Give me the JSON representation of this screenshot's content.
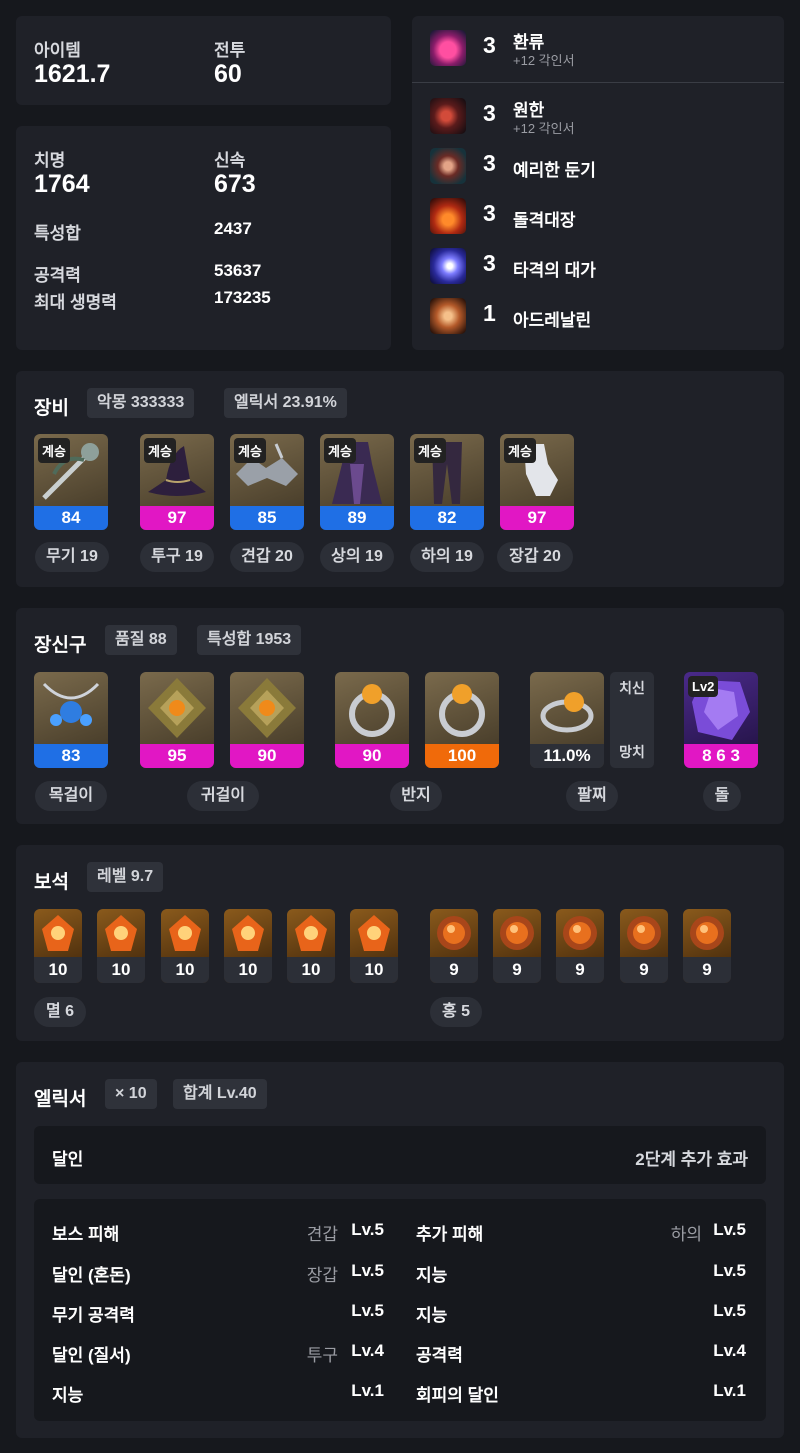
{
  "stats_top": {
    "item_label": "아이템",
    "item_value": "1621.7",
    "combat_label": "전투",
    "combat_value": "60"
  },
  "stats": {
    "crit_label": "치명",
    "crit_value": "1764",
    "swift_label": "신속",
    "swift_value": "673",
    "trait_sum_label": "특성합",
    "trait_sum_value": "2437",
    "atk_label": "공격력",
    "atk_value": "53637",
    "hp_label": "최대 생명력",
    "hp_value": "173235"
  },
  "engravings": [
    {
      "icon": "reflux-icon",
      "level": "3",
      "name": "환류",
      "sub": "+12 각인서"
    },
    {
      "icon": "grudge-icon",
      "level": "3",
      "name": "원한",
      "sub": "+12 각인서"
    },
    {
      "icon": "keen-blunt-icon",
      "level": "3",
      "name": "예리한 둔기",
      "sub": ""
    },
    {
      "icon": "raid-captain-icon",
      "level": "3",
      "name": "돌격대장",
      "sub": ""
    },
    {
      "icon": "master-brawler-icon",
      "level": "3",
      "name": "타격의 대가",
      "sub": ""
    },
    {
      "icon": "adrenaline-icon",
      "level": "1",
      "name": "아드레날린",
      "sub": ""
    }
  ],
  "equipment": {
    "title": "장비",
    "tag1": "악몽 333333",
    "tag2": "엘릭서 23.91%",
    "items": [
      {
        "badge": "계승",
        "quality": "84",
        "color": "blue",
        "label": "무기 19",
        "icon": "weapon-icon"
      },
      {
        "badge": "계승",
        "quality": "97",
        "color": "magenta",
        "label": "투구 19",
        "icon": "helmet-icon"
      },
      {
        "badge": "계승",
        "quality": "85",
        "color": "blue",
        "label": "견갑 20",
        "icon": "shoulder-icon"
      },
      {
        "badge": "계승",
        "quality": "89",
        "color": "blue",
        "label": "상의 19",
        "icon": "chest-icon"
      },
      {
        "badge": "계승",
        "quality": "82",
        "color": "blue",
        "label": "하의 19",
        "icon": "pants-icon"
      },
      {
        "badge": "계승",
        "quality": "97",
        "color": "magenta",
        "label": "장갑 20",
        "icon": "gloves-icon"
      }
    ]
  },
  "accessories": {
    "title": "장신구",
    "tag1": "품질 88",
    "tag2": "특성합 1953",
    "necklace_quality": "83",
    "earring1_quality": "95",
    "earring2_quality": "90",
    "ring1_quality": "90",
    "ring2_quality": "100",
    "bracelet_value": "11.0%",
    "bracelet_stat1": "치신",
    "bracelet_stat2": "망치",
    "stone_badge": "Lv2",
    "stone_value": "8 6 3",
    "labels": {
      "necklace": "목걸이",
      "earring": "귀걸이",
      "ring": "반지",
      "bracelet": "팔찌",
      "stone": "돌"
    }
  },
  "gems": {
    "title": "보석",
    "tag1": "레벨 9.7",
    "doom": [
      "10",
      "10",
      "10",
      "10",
      "10",
      "10"
    ],
    "crimson": [
      "9",
      "9",
      "9",
      "9",
      "9"
    ],
    "doom_label": "멸 6",
    "crimson_label": "홍 5"
  },
  "elixir": {
    "title": "엘릭서",
    "tag1": "× 10",
    "tag2": "합계 Lv.40",
    "set_name": "달인",
    "set_effect": "2단계 추가 효과",
    "left": [
      {
        "name": "보스 피해",
        "slot": "견갑",
        "level": "Lv.5"
      },
      {
        "name": "달인 (혼돈)",
        "slot": "장갑",
        "level": "Lv.5"
      },
      {
        "name": "무기 공격력",
        "slot": "",
        "level": "Lv.5"
      },
      {
        "name": "달인 (질서)",
        "slot": "투구",
        "level": "Lv.4"
      },
      {
        "name": "지능",
        "slot": "",
        "level": "Lv.1"
      }
    ],
    "right": [
      {
        "name": "추가 피해",
        "slot": "하의",
        "level": "Lv.5"
      },
      {
        "name": "지능",
        "slot": "",
        "level": "Lv.5"
      },
      {
        "name": "지능",
        "slot": "",
        "level": "Lv.5"
      },
      {
        "name": "공격력",
        "slot": "",
        "level": "Lv.4"
      },
      {
        "name": "회피의 달인",
        "slot": "",
        "level": "Lv.1"
      }
    ]
  },
  "colors": {
    "blue": "#1f6fe5",
    "magenta": "#e117c4",
    "orange": "#f06a0a",
    "card": "#1f2128",
    "bg": "#16181d"
  }
}
